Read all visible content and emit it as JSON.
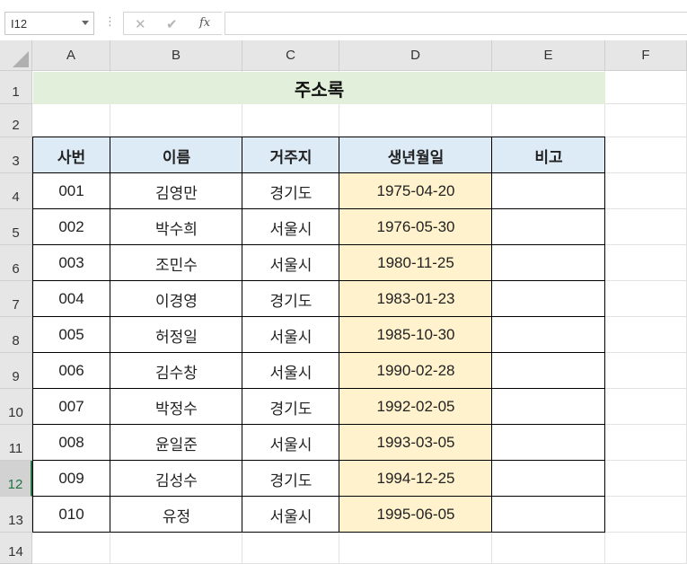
{
  "formula_bar": {
    "name_box": "I12",
    "dots": "⋮",
    "cancel": "✕",
    "enter": "✔",
    "fx": "fx",
    "formula": ""
  },
  "columns": [
    "A",
    "B",
    "C",
    "D",
    "E",
    "F"
  ],
  "rows": [
    "1",
    "2",
    "3",
    "4",
    "5",
    "6",
    "7",
    "8",
    "9",
    "10",
    "11",
    "12",
    "13",
    "14"
  ],
  "active_row": "12",
  "title": "주소록",
  "table": {
    "headers": [
      "사번",
      "이름",
      "거주지",
      "생년월일",
      "비고"
    ],
    "rows": [
      [
        "001",
        "김영만",
        "경기도",
        "1975-04-20",
        ""
      ],
      [
        "002",
        "박수희",
        "서울시",
        "1976-05-30",
        ""
      ],
      [
        "003",
        "조민수",
        "서울시",
        "1980-11-25",
        ""
      ],
      [
        "004",
        "이경영",
        "경기도",
        "1983-01-23",
        ""
      ],
      [
        "005",
        "허정일",
        "서울시",
        "1985-10-30",
        ""
      ],
      [
        "006",
        "김수창",
        "서울시",
        "1990-02-28",
        ""
      ],
      [
        "007",
        "박정수",
        "경기도",
        "1992-02-05",
        ""
      ],
      [
        "008",
        "윤일준",
        "서울시",
        "1993-03-05",
        ""
      ],
      [
        "009",
        "김성수",
        "경기도",
        "1994-12-25",
        ""
      ],
      [
        "010",
        "유정",
        "서울시",
        "1995-06-05",
        ""
      ]
    ]
  },
  "colors": {
    "title_fill": "#e2efda",
    "header_fill": "#ddebf7",
    "date_fill": "#fff2cc",
    "active_accent": "#217346"
  }
}
